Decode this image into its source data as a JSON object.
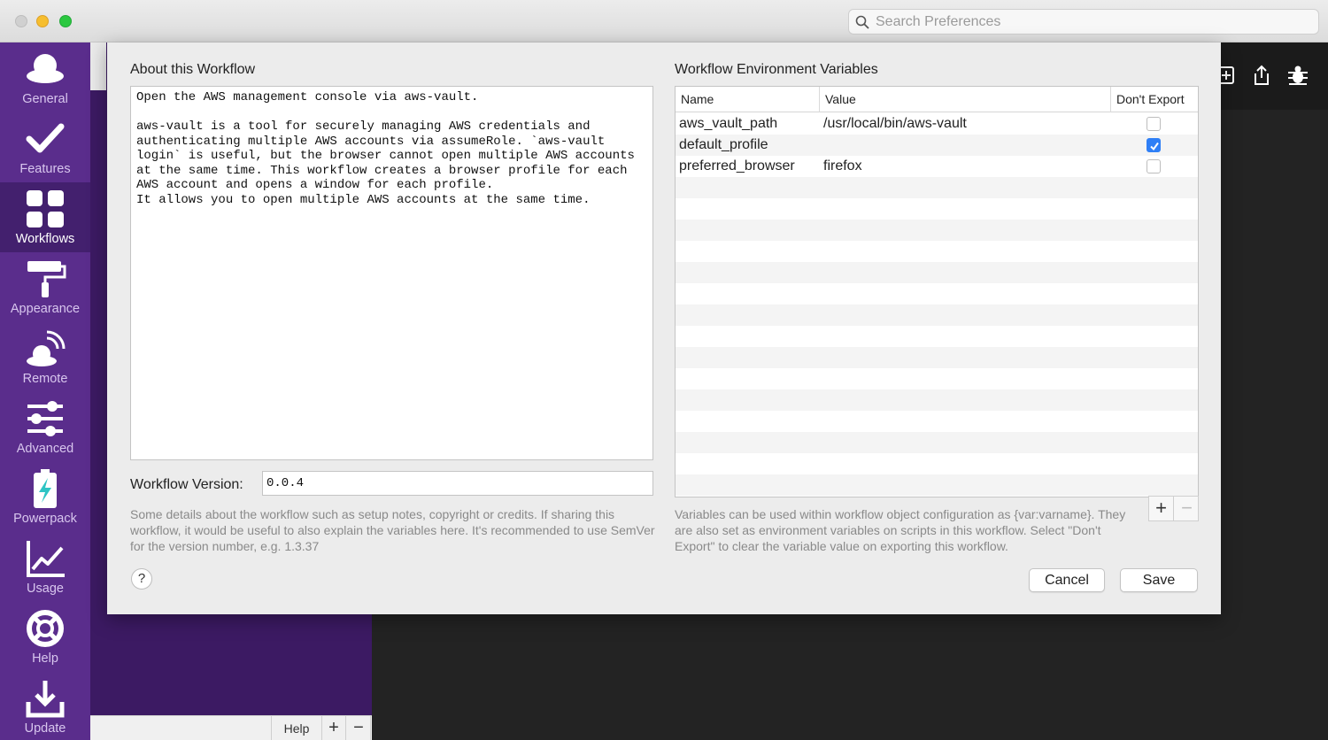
{
  "window": {
    "search_placeholder": "Search Preferences"
  },
  "sidebar": {
    "items": [
      {
        "label": "General",
        "icon": "hat-icon"
      },
      {
        "label": "Features",
        "icon": "checkmark-icon"
      },
      {
        "label": "Workflows",
        "icon": "grid-icon",
        "active": true
      },
      {
        "label": "Appearance",
        "icon": "paint-roller-icon"
      },
      {
        "label": "Remote",
        "icon": "remote-icon"
      },
      {
        "label": "Advanced",
        "icon": "sliders-icon"
      },
      {
        "label": "Powerpack",
        "icon": "battery-bolt-icon"
      },
      {
        "label": "Usage",
        "icon": "line-chart-icon"
      },
      {
        "label": "Help",
        "icon": "lifebuoy-icon"
      },
      {
        "label": "Update",
        "icon": "download-icon"
      }
    ]
  },
  "background": {
    "help_label": "Help",
    "plus_label": "+",
    "minus_label": "−"
  },
  "dialog": {
    "about_title": "About this Workflow",
    "about_text": "Open the AWS management console via aws-vault.\n\naws-vault is a tool for securely managing AWS credentials and\nauthenticating multiple AWS accounts via assumeRole. `aws-vault\nlogin` is useful, but the browser cannot open multiple AWS accounts\nat the same time. This workflow creates a browser profile for each\nAWS account and opens a window for each profile.\nIt allows you to open multiple AWS accounts at the same time.",
    "version_label": "Workflow Version:",
    "version_value": "0.0.4",
    "about_hint": "Some details about the workflow such as setup notes, copyright or credits. If sharing this workflow, it would be useful to also explain the variables here. It's recommended to use SemVer for the version number, e.g. 1.3.37",
    "help_label": "?",
    "env_title": "Workflow Environment Variables",
    "columns": {
      "name": "Name",
      "value": "Value",
      "dont_export": "Don't Export"
    },
    "variables": [
      {
        "name": "aws_vault_path",
        "value": "/usr/local/bin/aws-vault",
        "dont_export": false
      },
      {
        "name": "default_profile",
        "value": "",
        "dont_export": true
      },
      {
        "name": "preferred_browser",
        "value": "firefox",
        "dont_export": false
      }
    ],
    "add_label": "+",
    "remove_label": "−",
    "env_hint": "Variables can be used within workflow object configuration as {var:varname}. They are also set as environment variables on scripts in this workflow. Select \"Don't Export\" to clear the variable value on exporting this workflow.",
    "cancel_label": "Cancel",
    "save_label": "Save"
  },
  "colors": {
    "sidebar": "#5a2d8c",
    "sidebar_active": "#43206e",
    "checkbox_checked": "#2f7ff6"
  }
}
